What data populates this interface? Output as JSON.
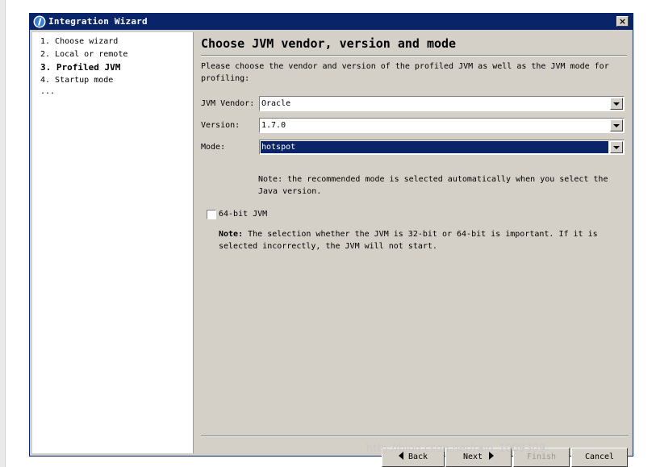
{
  "window": {
    "title": "Integration Wizard",
    "close_label": "×"
  },
  "steps": [
    {
      "label": "1. Choose wizard"
    },
    {
      "label": "2. Local or remote"
    },
    {
      "label": "3. Profiled JVM"
    },
    {
      "label": "4. Startup mode"
    },
    {
      "label": "..."
    }
  ],
  "page": {
    "heading": "Choose JVM vendor, version and mode",
    "description": "Please choose the vendor and version of the profiled JVM as well as the JVM mode for profiling:"
  },
  "fields": {
    "vendor_label": "JVM Vendor:",
    "vendor_value": "Oracle",
    "version_label": "Version:",
    "version_value": "1.7.0",
    "mode_label": "Mode:",
    "mode_value": "hotspot"
  },
  "mode_note": "Note: the recommended mode is selected automatically when you select the Java version.",
  "checkbox": {
    "label": "64-bit JVM",
    "checked": false
  },
  "bitness_note": {
    "bold": "Note:",
    "text": " The selection whether the JVM is 32-bit or 64-bit is important. If it is selected incorrectly, the JVM will not start."
  },
  "buttons": {
    "back": "Back",
    "next": "Next",
    "finish": "Finish",
    "cancel": "Cancel"
  },
  "watermark": "http://blog.csdn.net/rain_1009309",
  "colors": {
    "title_bar": "#0a246a",
    "dialog_bg": "#d4d0c8",
    "selection": "#0a246a"
  }
}
